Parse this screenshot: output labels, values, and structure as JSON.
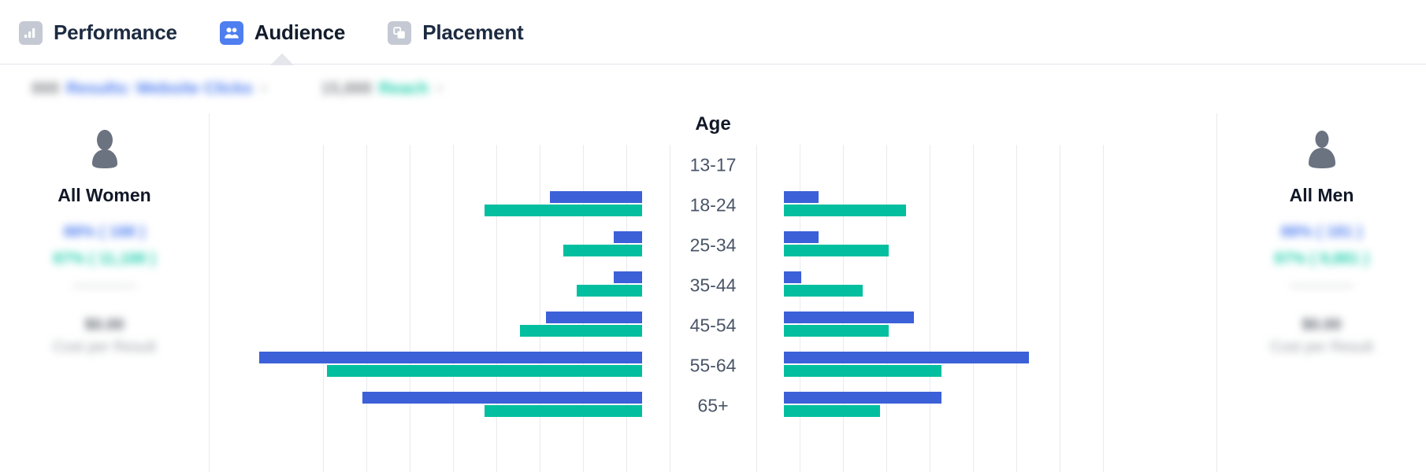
{
  "tabs": [
    {
      "label": "Performance",
      "icon": "bar-chart-icon",
      "active": false
    },
    {
      "label": "Audience",
      "icon": "people-icon",
      "active": true
    },
    {
      "label": "Placement",
      "icon": "windows-icon",
      "active": false
    }
  ],
  "legend": {
    "groups": [
      {
        "count": "888",
        "metric": "Results: Website Clicks",
        "remove": "×",
        "color": "#4e7ef0"
      },
      {
        "count": "15,888",
        "metric": "Reach",
        "remove": "×",
        "color": "#1ecfad"
      }
    ]
  },
  "women": {
    "icon": "woman-silhouette-icon",
    "title": "All Women",
    "stat_results": "88% ( 188 )",
    "stat_reach": "87% ( 11,188 )",
    "stat_muted": "————",
    "cost_value": "$0.00",
    "cost_label": "Cost per Result"
  },
  "men": {
    "icon": "man-silhouette-icon",
    "title": "All Men",
    "stat_results": "88% ( 181 )",
    "stat_reach": "87% ( 9,881 )",
    "stat_muted": "————",
    "cost_value": "$0.00",
    "cost_label": "Cost per Result"
  },
  "colors": {
    "results_blue": "#3b60d8",
    "reach_teal": "#03bfa0",
    "tab_active": "#4e7ef0",
    "tab_inactive": "#c4c9d4",
    "gridline": "#e9eaec"
  },
  "chart_data": {
    "type": "bar",
    "title": "Age",
    "orientation": "horizontal-diverging",
    "categories": [
      "13-17",
      "18-24",
      "25-34",
      "35-44",
      "45-54",
      "55-64",
      "65+"
    ],
    "xlabel": "",
    "ylabel": "Age",
    "grid": true,
    "legend_position": "top-left",
    "sides": [
      "All Women",
      "All Men"
    ],
    "series": [
      {
        "name": "Results: Website Clicks",
        "color": "#3b60d8",
        "women": [
          0,
          117,
          36,
          36,
          122,
          486,
          355
        ],
        "men": [
          0,
          44,
          44,
          22,
          165,
          311,
          200
        ]
      },
      {
        "name": "Reach",
        "color": "#03bfa0",
        "women": [
          0,
          200,
          100,
          83,
          155,
          400,
          200
        ],
        "men": [
          0,
          155,
          133,
          100,
          133,
          200,
          122
        ]
      }
    ],
    "axis_max": 500,
    "axis_tick_spacing": 55,
    "note": "Bar lengths read in pixels off the gridlines; diverging pyramid with women on left and men on right."
  }
}
